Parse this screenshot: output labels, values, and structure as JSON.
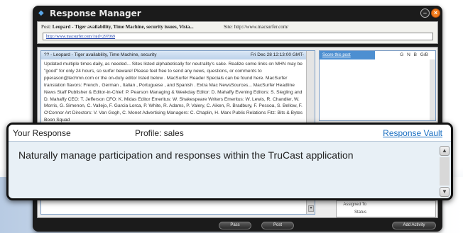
{
  "window": {
    "title": "Response Manager",
    "minimize_glyph": "–",
    "close_glyph": "×"
  },
  "post": {
    "label": "Post:",
    "title": "Leopard - Tiger availability, Time Machine, security issues, Vista...",
    "site_label": "Site:",
    "site_url": "http://www.macsurfer.com/",
    "link": "http://www.macsurfer.com/?aid=297069"
  },
  "post_view": {
    "header": "?? - Leopard - Tiger availability, Time Machine, security",
    "date": "Fri Dec 28 12:13:00 GMT-",
    "body": "Updated multiple times daily, as needed... Sites listed alphabetically for neutrality's sake. Realize some links on MHN may be \"good\" for only 24 hours, so surfer beware! Please feel free to send any news, questions, or comments to pperason@techmn.com or the on-duty editor listed below . MacSurfer Reader Specials can be found here. MacSurfer translation flavors: French , German , Italian , Portuguese , and Spanish . Extra Mac NewsSources... MacSurfer Headline News Staff Publisher & Editor-in-Chief: P. Pearson Managing & Weekday Editor: D. Mahaffy Evening Editors: S. Siegling and D. Mahaffy CEO: T. Jefferson CFO: K. Midas Editor Emeritus: W. Shakespeare Writers Emeritus: W. Lewis, R. Chandler, W. Morris, G. Simenon, C. Vallejo, F. Garcia Lorca, P. White, R. Adams, P. Valery, C. Aiken, R. Bradbury, F. Pessoa, S. Bellow, F. O'Connor Art Directors: V. Van Gogh, C. Monet Advertising Managers: C. Chaplin, H. Marx Public Relations Fitz: Bits & Bytes Boon Squad"
  },
  "score": {
    "link": "Score this post",
    "tabs": "G N B G/B"
  },
  "details": {
    "assigned_to": "Assigned To",
    "status": "Status"
  },
  "bottom": {
    "pass": "Pass",
    "post": "Post",
    "add_activity": "Add Activity"
  },
  "response": {
    "title": "Your Response",
    "profile": "Profile: sales",
    "vault": "Response Vault",
    "text": "Naturally manage participation and responses within the TruCast application",
    "scroll_up": "▲",
    "scroll_down": "▼"
  }
}
